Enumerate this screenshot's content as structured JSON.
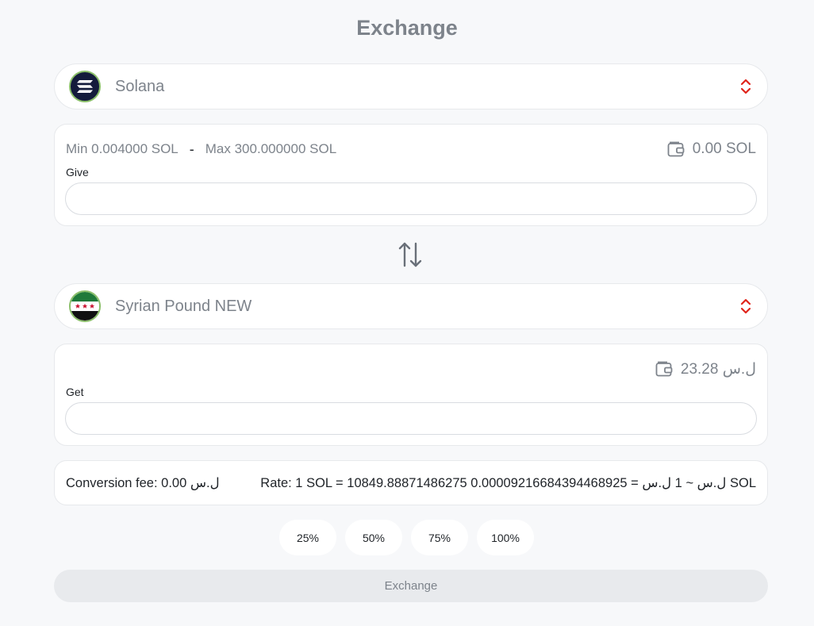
{
  "title": "Exchange",
  "from": {
    "currency": "Solana",
    "min_label": "Min 0.004000 SOL",
    "separator": "-",
    "max_label": "Max 300.000000 SOL",
    "balance": "0.00 SOL",
    "field_label": "Give",
    "value": "",
    "placeholder": ""
  },
  "to": {
    "currency": "Syrian Pound NEW",
    "balance": "23.28 ل.س",
    "field_label": "Get",
    "value": "",
    "placeholder": ""
  },
  "info": {
    "fee": "Conversion fee: 0.00 ل.س",
    "rate": "Rate: 1 SOL = 10849.88871486275 ل.س ~ 1 ل.س = 0.00009216684394468925 SOL"
  },
  "percent_buttons": [
    "25%",
    "50%",
    "75%",
    "100%"
  ],
  "exchange_button": "Exchange",
  "colors": {
    "accent_arrows": "#e0241b",
    "muted_text": "#7d838b",
    "flag_green": "#1f7a3a",
    "flag_red": "#c8102e"
  }
}
